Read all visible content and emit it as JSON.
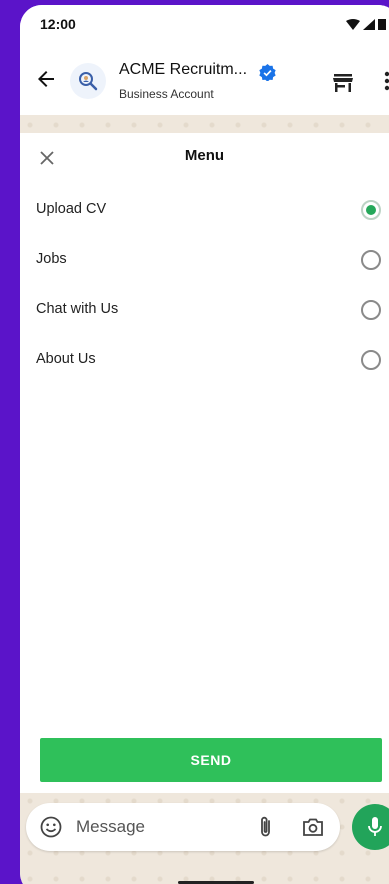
{
  "status": {
    "time": "12:00"
  },
  "header": {
    "title": "ACME Recruitm...",
    "subtitle": "Business Account"
  },
  "menu": {
    "title": "Menu",
    "options": [
      {
        "label": "Upload CV",
        "selected": true
      },
      {
        "label": "Jobs",
        "selected": false
      },
      {
        "label": "Chat with Us",
        "selected": false
      },
      {
        "label": "About Us",
        "selected": false
      }
    ],
    "send_label": "SEND"
  },
  "composer": {
    "placeholder": "Message"
  },
  "colors": {
    "accent": "#2fc05a",
    "radio_selected": "#25a85a",
    "mic": "#22a45a",
    "verified": "#1a73e8",
    "background": "#5b14c9"
  },
  "icons": [
    "back-arrow-icon",
    "avatar-magnifier-icon",
    "verified-badge-icon",
    "store-icon",
    "more-vert-icon",
    "close-icon",
    "emoji-icon",
    "attach-icon",
    "camera-icon",
    "mic-icon"
  ]
}
